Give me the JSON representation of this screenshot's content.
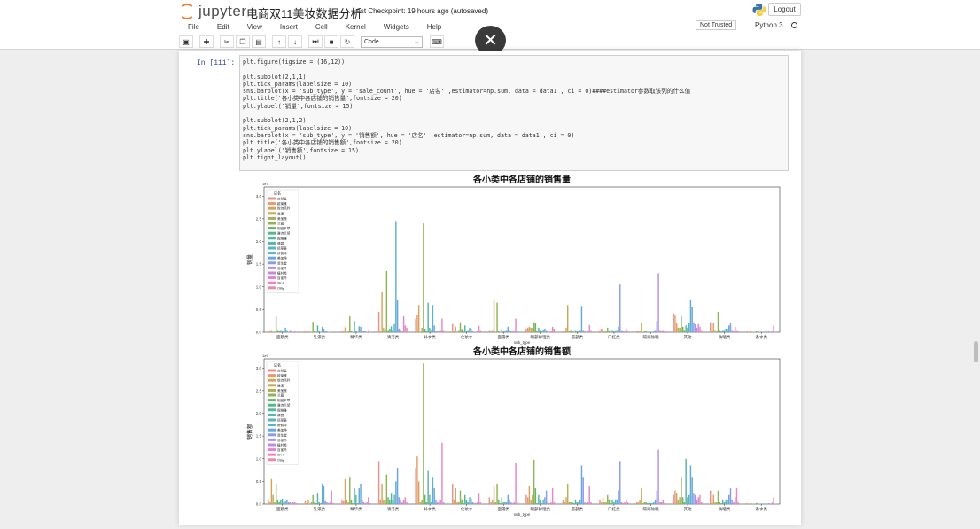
{
  "app": {
    "logo_text": "jupyter",
    "notebook_title": "电商双11美妆数据分析",
    "checkpoint": "Last Checkpoint: 19 hours ago (autosaved)",
    "logout_label": "Logout",
    "trusted_label": "Not Trusted",
    "kernel_label": "Python 3"
  },
  "menu": [
    "File",
    "Edit",
    "View",
    "Insert",
    "Cell",
    "Kernel",
    "Widgets",
    "Help"
  ],
  "toolbar": {
    "buttons": [
      "save-icon",
      "plus-icon",
      "cut-icon",
      "copy-icon",
      "paste-icon",
      "arrow-up-icon",
      "arrow-down-icon",
      "step-forward-icon",
      "stop-icon",
      "restart-icon"
    ],
    "cell_type": "Code",
    "keyboard_icon": "keyboard-icon",
    "close_icon": "close-icon"
  },
  "cell": {
    "prompt": "In  [111]:",
    "code_lines": [
      "plt.figure(figsize = (16,12))",
      "",
      "plt.subplot(2,1,1)",
      "plt.tick_params(labelsize = 10)",
      "sns.barplot(x = 'sub_type', y = 'sale_count', hue = '店名' ,estimator=np.sum, data = data1 , ci = 0)####estimator参数取该列的什么值",
      "plt.title('各小类中各店铺的销售量',fontsize = 20)",
      "plt.ylabel('销量',fontsize = 15)",
      "",
      "plt.subplot(2,1,2)",
      "plt.tick_params(labelsize = 10)",
      "sns.barplot(x = 'sub_type', y = '销售额', hue = '店名' ,estimator=np.sum, data = data1 , ci = 0)",
      "plt.title('各小类中各店铺的销售额',fontsize = 20)",
      "plt.ylabel('销售额',fontsize = 15)",
      "plt.tight_layout()"
    ]
  },
  "chart_data": [
    {
      "type": "bar",
      "title": "各小类中各店铺的销售量",
      "xlabel": "sub_type",
      "ylabel": "销量",
      "scale_label": "1e7",
      "ylim": [
        0,
        3.2
      ],
      "yticks": [
        0.0,
        0.5,
        1.0,
        1.5,
        2.0,
        2.5,
        3.0
      ],
      "legend_title": "店名",
      "legend_position": "top-left",
      "categories": [
        "面膜类",
        "乳液类",
        "精华类",
        "清洁类",
        "补水类",
        "化妆水",
        "面霜类",
        "眼部护理类",
        "唇部类",
        "口红类",
        "隔离防晒",
        "其他",
        "防晒类",
        "香水类"
      ],
      "series_names": [
        "自然堂",
        "欧莱雅",
        "悦诗风吟",
        "雅漾",
        "美宝莲",
        "兰蔻",
        "相宜本草",
        "雅诗兰黛",
        "妮维雅",
        "倩碧",
        "佰草集",
        "娇韵诗",
        "美加净",
        "资生堂",
        "佰雀羚",
        "植村秀",
        "百雀羚",
        "SK-II",
        "Olay"
      ],
      "series_colors": [
        "#e8928c",
        "#e79a6f",
        "#d6a35c",
        "#c3aa5a",
        "#aaae58",
        "#8db456",
        "#6cb35d",
        "#56b78a",
        "#55b69e",
        "#58b4ac",
        "#5bb3bd",
        "#5faed3",
        "#6aa6e0",
        "#8c9ce7",
        "#ad93e6",
        "#c589e2",
        "#da85d6",
        "#e588c2",
        "#ea8aa9"
      ],
      "values": [
        [
          0.02,
          0.02,
          0.05,
          0.0,
          0.01,
          0.35,
          0.05,
          0.02,
          0.05,
          0.02,
          0.02,
          0.1,
          0.05,
          0.01,
          0.05,
          0.02,
          0.01,
          0.02,
          0.01
        ],
        [
          0.02,
          0.01,
          0.03,
          0.0,
          0.01,
          0.23,
          0.02,
          0.01,
          0.15,
          0.02,
          0.01,
          0.12,
          0.08,
          0.02,
          0.02,
          0.01,
          0.01,
          0.0,
          0.0
        ],
        [
          0.03,
          0.02,
          0.11,
          0.0,
          0.02,
          0.35,
          0.03,
          0.01,
          0.25,
          0.02,
          0.01,
          0.13,
          0.12,
          0.04,
          0.03,
          0.02,
          0.01,
          0.05,
          0.01
        ],
        [
          0.45,
          0.04,
          0.88,
          0.1,
          0.05,
          1.35,
          0.05,
          0.08,
          0.13,
          0.05,
          0.18,
          2.45,
          0.72,
          0.08,
          0.06,
          0.02,
          0.35,
          0.15,
          0.1
        ],
        [
          0.3,
          0.38,
          0.6,
          0.0,
          0.1,
          2.4,
          0.08,
          0.03,
          0.65,
          0.1,
          0.05,
          0.6,
          0.15,
          0.02,
          0.03,
          0.02,
          0.05,
          0.3,
          0.05
        ],
        [
          0.18,
          0.04,
          0.12,
          0.0,
          0.05,
          0.22,
          0.07,
          0.02,
          0.15,
          0.04,
          0.05,
          0.1,
          0.08,
          0.02,
          0.01,
          0.01,
          0.03,
          0.14,
          0.05
        ],
        [
          0.05,
          0.03,
          0.05,
          0.72,
          0.0,
          0.65,
          0.04,
          0.01,
          0.08,
          0.02,
          0.03,
          0.05,
          0.12,
          0.05,
          0.04,
          0.02,
          0.03,
          0.3,
          0.02
        ],
        [
          0.08,
          0.1,
          0.12,
          0.1,
          0.1,
          0.22,
          0.2,
          0.02,
          0.1,
          0.05,
          0.02,
          0.06,
          0.08,
          0.05,
          0.03,
          0.01,
          0.02,
          0.12,
          0.08
        ],
        [
          0.02,
          0.02,
          0.1,
          0.6,
          0.02,
          0.05,
          0.03,
          0.0,
          0.05,
          0.02,
          0.02,
          0.05,
          0.58,
          0.05,
          0.02,
          0.01,
          0.04,
          0.16,
          0.05
        ],
        [
          0.05,
          0.08,
          0.05,
          0.02,
          0.02,
          0.1,
          0.04,
          0.01,
          0.05,
          0.03,
          0.04,
          0.05,
          0.12,
          1.05,
          0.05,
          0.02,
          0.04,
          0.08,
          0.04
        ],
        [
          0.02,
          0.02,
          0.03,
          0.22,
          0.01,
          0.03,
          0.02,
          0.01,
          0.02,
          0.01,
          0.01,
          0.02,
          0.05,
          0.25,
          1.3,
          0.05,
          0.02,
          0.05,
          0.02
        ],
        [
          0.42,
          0.38,
          0.2,
          0.1,
          0.1,
          0.35,
          0.12,
          0.05,
          0.15,
          0.1,
          0.2,
          0.72,
          0.55,
          0.22,
          0.18,
          0.1,
          0.18,
          0.12,
          0.05
        ],
        [
          0.22,
          0.05,
          0.2,
          0.05,
          0.02,
          0.45,
          0.05,
          0.02,
          0.05,
          0.05,
          0.08,
          0.08,
          0.15,
          0.2,
          0.05,
          0.02,
          0.12,
          0.05,
          0.02
        ],
        [
          0.02,
          0.01,
          0.02,
          0.0,
          0.01,
          0.01,
          0.02,
          0.01,
          0.01,
          0.0,
          0.0,
          0.01,
          0.02,
          0.0,
          0.02,
          0.01,
          0.03,
          0.15,
          0.01
        ]
      ]
    },
    {
      "type": "bar",
      "title": "各小类中各店铺的销售额",
      "xlabel": "sub_type",
      "ylabel": "销售额",
      "scale_label": "1e9",
      "ylim": [
        0,
        3.2
      ],
      "yticks": [
        0.0,
        0.5,
        1.0,
        1.5,
        2.0,
        2.5,
        3.0
      ],
      "legend_title": "店名",
      "legend_position": "top-left",
      "categories": [
        "面膜类",
        "乳液类",
        "精华类",
        "清洁类",
        "补水类",
        "化妆水",
        "面霜类",
        "眼部护理类",
        "唇部类",
        "口红类",
        "隔离防晒",
        "其他",
        "防晒类",
        "香水类"
      ],
      "series_names": [
        "自然堂",
        "欧莱雅",
        "悦诗风吟",
        "雅漾",
        "美宝莲",
        "兰蔻",
        "相宜本草",
        "雅诗兰黛",
        "妮维雅",
        "倩碧",
        "佰草集",
        "娇韵诗",
        "美加净",
        "资生堂",
        "佰雀羚",
        "植村秀",
        "百雀羚",
        "SK-II",
        "Olay"
      ],
      "series_colors": [
        "#e8928c",
        "#e79a6f",
        "#d6a35c",
        "#c3aa5a",
        "#aaae58",
        "#8db456",
        "#6cb35d",
        "#56b78a",
        "#55b69e",
        "#58b4ac",
        "#5bb3bd",
        "#5faed3",
        "#6aa6e0",
        "#8c9ce7",
        "#ad93e6",
        "#c589e2",
        "#da85d6",
        "#e588c2",
        "#ea8aa9"
      ],
      "values": [
        [
          0.1,
          0.05,
          0.55,
          0.2,
          0.05,
          0.45,
          0.1,
          0.05,
          0.1,
          0.12,
          0.05,
          0.08,
          0.1,
          0.05,
          0.05,
          0.02,
          0.05,
          0.05,
          0.02
        ],
        [
          0.08,
          0.02,
          0.1,
          0.0,
          0.05,
          0.2,
          0.05,
          0.02,
          0.25,
          0.05,
          0.02,
          0.45,
          0.4,
          0.08,
          0.05,
          0.02,
          0.05,
          0.3,
          0.02
        ],
        [
          0.1,
          0.08,
          0.55,
          0.1,
          0.05,
          0.6,
          0.1,
          0.02,
          0.35,
          0.2,
          0.02,
          0.35,
          0.45,
          0.1,
          0.05,
          0.02,
          0.05,
          0.15,
          0.02
        ],
        [
          0.95,
          0.1,
          0.45,
          0.1,
          0.1,
          0.65,
          0.15,
          0.1,
          0.25,
          0.1,
          0.2,
          0.5,
          0.8,
          0.15,
          0.1,
          0.05,
          0.1,
          0.15,
          0.05
        ],
        [
          0.8,
          1.05,
          0.5,
          0.05,
          0.1,
          3.1,
          0.2,
          0.05,
          0.75,
          0.2,
          0.05,
          0.6,
          0.35,
          0.1,
          0.05,
          0.05,
          0.1,
          1.35,
          0.05
        ],
        [
          0.45,
          0.1,
          0.35,
          0.05,
          0.05,
          0.3,
          0.1,
          0.02,
          0.2,
          0.1,
          0.05,
          0.15,
          0.12,
          0.05,
          0.02,
          0.02,
          0.05,
          0.25,
          0.05
        ],
        [
          0.15,
          0.05,
          0.1,
          0.4,
          0.05,
          0.45,
          0.1,
          0.02,
          0.15,
          0.05,
          0.05,
          0.05,
          0.2,
          0.1,
          0.05,
          0.02,
          0.05,
          0.9,
          0.05
        ],
        [
          0.2,
          0.15,
          0.4,
          0.1,
          0.2,
          0.98,
          0.35,
          0.02,
          0.2,
          0.1,
          0.02,
          0.1,
          0.15,
          0.3,
          0.05,
          0.02,
          0.05,
          0.35,
          0.05
        ],
        [
          0.1,
          0.05,
          0.15,
          0.45,
          0.05,
          0.05,
          0.05,
          0.02,
          0.1,
          0.05,
          0.05,
          0.1,
          0.85,
          0.6,
          0.05,
          0.02,
          0.05,
          0.4,
          0.05
        ],
        [
          0.1,
          0.05,
          0.15,
          0.05,
          0.05,
          0.2,
          0.1,
          0.02,
          0.1,
          0.05,
          0.1,
          0.1,
          0.3,
          0.95,
          0.05,
          0.02,
          0.05,
          0.1,
          0.05
        ],
        [
          0.05,
          0.05,
          0.1,
          0.35,
          0.02,
          0.05,
          0.05,
          0.02,
          0.05,
          0.02,
          0.02,
          0.05,
          0.1,
          0.3,
          1.2,
          0.05,
          0.05,
          0.1,
          0.02
        ],
        [
          0.2,
          0.3,
          0.25,
          0.1,
          0.15,
          0.6,
          0.15,
          0.05,
          1.0,
          0.15,
          0.2,
          0.85,
          0.6,
          0.25,
          0.2,
          0.1,
          0.15,
          0.2,
          0.05
        ],
        [
          0.3,
          0.05,
          0.2,
          0.05,
          0.05,
          0.3,
          0.05,
          0.02,
          0.1,
          0.05,
          0.1,
          0.1,
          0.2,
          0.35,
          0.1,
          0.05,
          0.15,
          0.35,
          0.05
        ],
        [
          0.02,
          0.01,
          0.02,
          0.0,
          0.01,
          0.01,
          0.02,
          0.01,
          0.01,
          0.0,
          0.0,
          0.01,
          0.02,
          0.0,
          0.02,
          0.01,
          0.03,
          0.15,
          0.01
        ]
      ]
    }
  ]
}
